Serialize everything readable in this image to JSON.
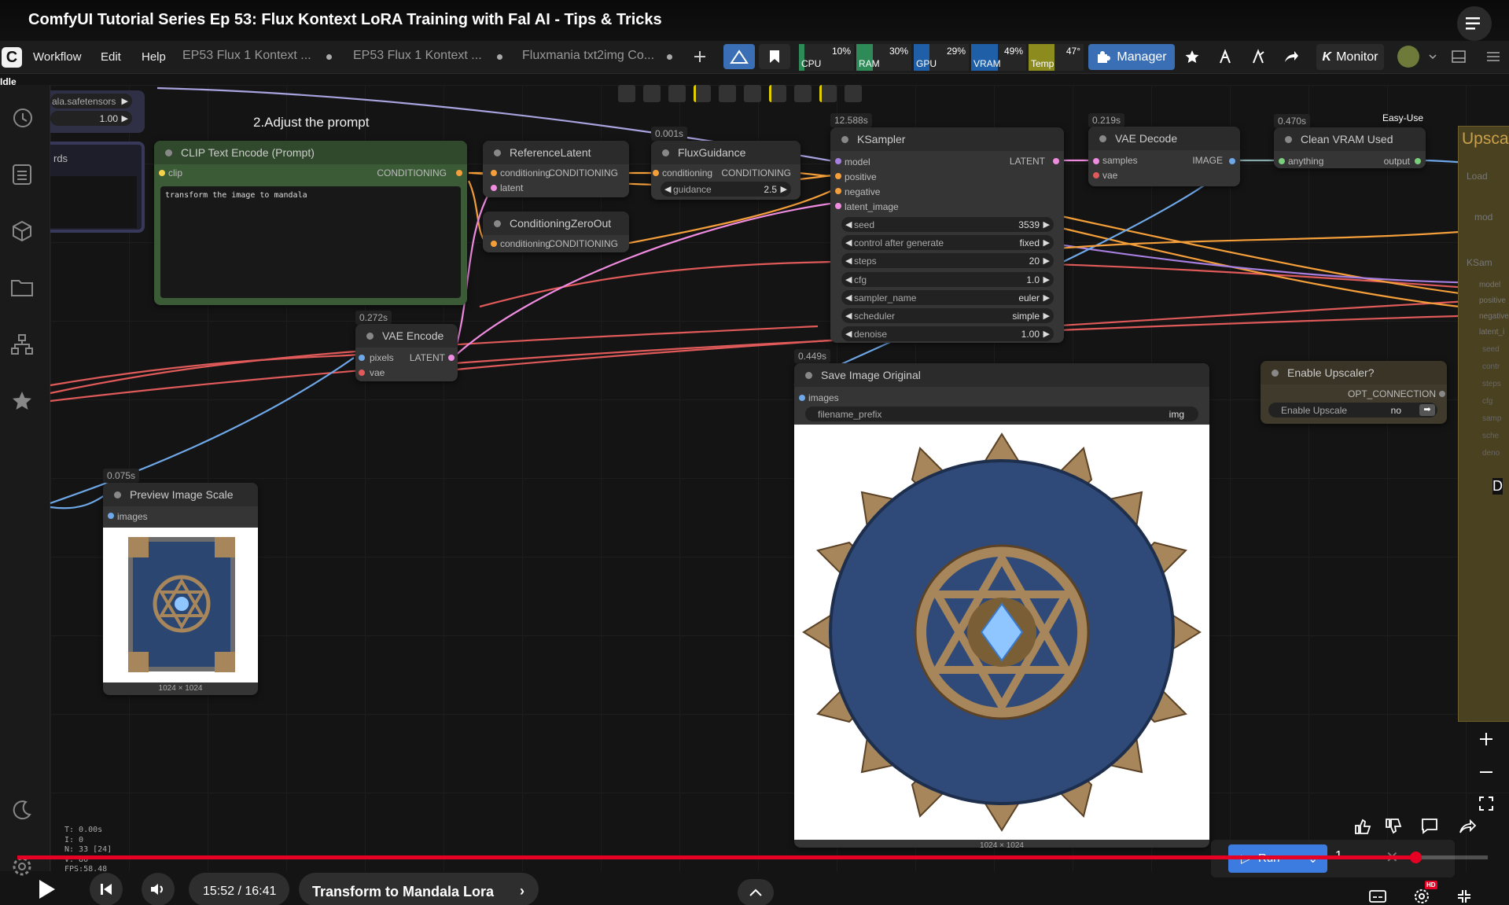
{
  "video": {
    "title": "ComfyUI Tutorial Series Ep 53: Flux Kontext LoRA Training with Fal AI - Tips & Tricks",
    "time": "15:52 / 16:41",
    "chapter": "Transform to Mandala Lora",
    "progress_fraction": 0.951
  },
  "menu": {
    "items": [
      "Workflow",
      "Edit",
      "Help"
    ],
    "tabs": [
      "EP53 Flux 1 Kontext ...",
      "EP53 Flux 1 Kontext ...",
      "Fluxmania txt2img Co..."
    ],
    "manager_label": "Manager",
    "monitor_label": "Monitor",
    "status": "Idle"
  },
  "monitor": {
    "cpu": {
      "value": "10%",
      "label": "CPU",
      "fraction": 0.1,
      "color": "#2e8b57"
    },
    "ram": {
      "value": "30%",
      "label": "RAM",
      "fraction": 0.3,
      "color": "#2e8b57"
    },
    "gpu": {
      "value": "29%",
      "label": "GPU",
      "fraction": 0.29,
      "color": "#1e5fa8"
    },
    "vram": {
      "value": "49%",
      "label": "VRAM",
      "fraction": 0.49,
      "color": "#1e5fa8"
    },
    "temp": {
      "value": "47°",
      "label": "Temp",
      "fraction": 0.47,
      "color": "#8c8c1e"
    }
  },
  "group": {
    "label": "2.Adjust the prompt",
    "partial_label": "rds"
  },
  "loader_partial": {
    "filename": "ala.safetensors",
    "strength": "1.00"
  },
  "nodes": {
    "clip": {
      "title": "CLIP Text Encode (Prompt)",
      "in": "clip",
      "out": "CONDITIONING",
      "text": "transform the image to mandala"
    },
    "ref_latent": {
      "title": "ReferenceLatent",
      "in1": "conditioning",
      "in2": "latent",
      "out": "CONDITIONING"
    },
    "cond_zero": {
      "title": "ConditioningZeroOut",
      "in": "conditioning",
      "out": "CONDITIONING"
    },
    "flux_guidance": {
      "time": "0.001s",
      "title": "FluxGuidance",
      "in": "conditioning",
      "out": "CONDITIONING",
      "widget_label": "guidance",
      "widget_value": "2.5"
    },
    "ksampler": {
      "time": "12.588s",
      "title": "KSampler",
      "inputs": [
        "model",
        "positive",
        "negative",
        "latent_image"
      ],
      "out": "LATENT",
      "widgets": [
        {
          "label": "seed",
          "value": "3539"
        },
        {
          "label": "control after generate",
          "value": "fixed"
        },
        {
          "label": "steps",
          "value": "20"
        },
        {
          "label": "cfg",
          "value": "1.0"
        },
        {
          "label": "sampler_name",
          "value": "euler"
        },
        {
          "label": "scheduler",
          "value": "simple"
        },
        {
          "label": "denoise",
          "value": "1.00"
        }
      ]
    },
    "vae_decode": {
      "time": "0.219s",
      "title": "VAE Decode",
      "in1": "samples",
      "in2": "vae",
      "out": "IMAGE"
    },
    "clean_vram": {
      "time": "0.470s",
      "title": "Clean VRAM Used",
      "in": "anything",
      "out": "output",
      "badge": "Easy-Use"
    },
    "vae_encode": {
      "time": "0.272s",
      "title": "VAE Encode",
      "in1": "pixels",
      "in2": "vae",
      "out": "LATENT"
    },
    "save_image": {
      "time": "0.449s",
      "title": "Save Image Original",
      "in": "images",
      "widget_label": "filename_prefix",
      "widget_value": "img",
      "image_size": "1024 × 1024"
    },
    "enable_upscaler": {
      "title": "Enable Upscaler?",
      "out": "OPT_CONNECTION",
      "widget_label": "Enable Upscale",
      "widget_value": "no"
    },
    "preview": {
      "time": "0.075s",
      "title": "Preview Image Scale",
      "in": "images",
      "image_size": "1024 × 1024"
    },
    "upscale_partial": {
      "title": "Upsca",
      "ports": [
        "model",
        "positive",
        "negative",
        "latent_i"
      ],
      "widgets": [
        "seed",
        "contr",
        "steps",
        "cfg",
        "samp",
        "sche",
        "deno"
      ],
      "load": "Load",
      "mod": "mod",
      "ksam": "KSam"
    }
  },
  "stats": {
    "t": "T: 0.00s",
    "i": "I: 0",
    "n": "N: 33 [24]",
    "v": "V: 80",
    "fps": "FPS:58.48"
  },
  "run": {
    "label": "Run",
    "count": "1"
  },
  "right_edge": {
    "letter": "D"
  },
  "colors": {
    "accent": "#3a6fb5",
    "progress": "#e60023",
    "clip_group": "#3b5a36"
  }
}
